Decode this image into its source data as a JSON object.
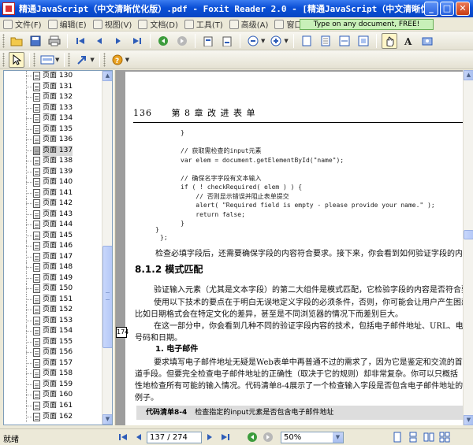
{
  "window": {
    "title": "精通JavaScript（中文清晰优化版）.pdf - Foxit Reader 2.0 - [精通JavaScript（中文清晰优化版...",
    "min": "_",
    "max": "□",
    "close": "✕"
  },
  "menu": {
    "items": [
      {
        "label": "文件(F)",
        "icon": "file-menu-icon"
      },
      {
        "label": "编辑(E)",
        "icon": "edit-menu-icon"
      },
      {
        "label": "视图(V)",
        "icon": "view-menu-icon"
      },
      {
        "label": "文档(D)",
        "icon": "document-menu-icon"
      },
      {
        "label": "工具(T)",
        "icon": "tools-menu-icon"
      },
      {
        "label": "高级(A)",
        "icon": "advanced-menu-icon"
      },
      {
        "label": "窗口(W)",
        "icon": "window-menu-icon"
      },
      {
        "label": "帮助(H)",
        "icon": "help-menu-icon"
      }
    ],
    "promo": "Type on any document, FREE!"
  },
  "bookmarks": {
    "prefix": "页面",
    "items": [
      {
        "label": "页面 130"
      },
      {
        "label": "页面 131"
      },
      {
        "label": "页面 132"
      },
      {
        "label": "页面 133"
      },
      {
        "label": "页面 134"
      },
      {
        "label": "页面 135"
      },
      {
        "label": "页面 136"
      },
      {
        "label": "页面 137",
        "selected": true
      },
      {
        "label": "页面 138"
      },
      {
        "label": "页面 139"
      },
      {
        "label": "页面 140"
      },
      {
        "label": "页面 141"
      },
      {
        "label": "页面 142"
      },
      {
        "label": "页面 143"
      },
      {
        "label": "页面 144"
      },
      {
        "label": "页面 145"
      },
      {
        "label": "页面 146"
      },
      {
        "label": "页面 147"
      },
      {
        "label": "页面 148"
      },
      {
        "label": "页面 149"
      },
      {
        "label": "页面 150"
      },
      {
        "label": "页面 151"
      },
      {
        "label": "页面 152"
      },
      {
        "label": "页面 153"
      },
      {
        "label": "页面 154"
      },
      {
        "label": "页面 155"
      },
      {
        "label": "页面 156"
      },
      {
        "label": "页面 157"
      },
      {
        "label": "页面 158"
      },
      {
        "label": "页面 159"
      },
      {
        "label": "页面 160"
      },
      {
        "label": "页面 161"
      },
      {
        "label": "页面 162"
      }
    ]
  },
  "page": {
    "number": "136",
    "chapter": "第 8 章   改 进 表 单",
    "code_lines": [
      "}",
      "",
      "// 获取需检查的input元素",
      "var elem = document.getElementById(\"name\");",
      "",
      "// 确保名字字段有文本输入",
      "if ( ! checkRequired( elem ) ) {",
      "    // 否则显示错误并阻止表单提交",
      "    alert( \"Required field is empty - please provide your name.\" );",
      "    return false;",
      "}"
    ],
    "code_tail_1": "}",
    "code_tail_2": "};",
    "para1": "检查必填字段后，还需要确保字段的内容符合要求。接下来，你会看到如何验证字段的内容。",
    "section": "8.1.2   模式匹配",
    "para2_l1": "验证输入元素（尤其是文本字段）的第二大组件是模式匹配，它检验字段的内容是否符合要求。",
    "para2_l2": "使用以下技术的要点在于明白无误地定义字段的必须条件，否则，你可能会让用户产生困惑。",
    "para2_l3": "比如日期格式会在特定文化的差异，甚至是不同浏览器的情况下而差别巨大。",
    "para3_l1": "在这一部分中，你会看到几种不同的验证字段内容的技术，包括电子邮件地址、URL、电话",
    "para3_l2": "号码和日期。",
    "subhead": "1. 电子邮件",
    "para4_l1": "要求填写电子邮件地址无疑是Web表单中再普通不过的需求了，因为它是鉴定和交流的首",
    "para4_l2": "道手段。但要完全检查电子邮件地址的正确性（取决于它的规则）却非常复杂。你可以只概括",
    "para4_l3": "性地检查所有可能的输入情况。代码清单8-4展示了一个检查输入字段是否包含电子邮件地址的",
    "para4_l4": "例子。",
    "listing_label": "代码清单8-4",
    "listing_text": "检查指定的input元素是否包含电子邮件地址",
    "marker": "174"
  },
  "status": {
    "text": "就绪",
    "page_input": "137 / 274",
    "zoom": "50%"
  }
}
